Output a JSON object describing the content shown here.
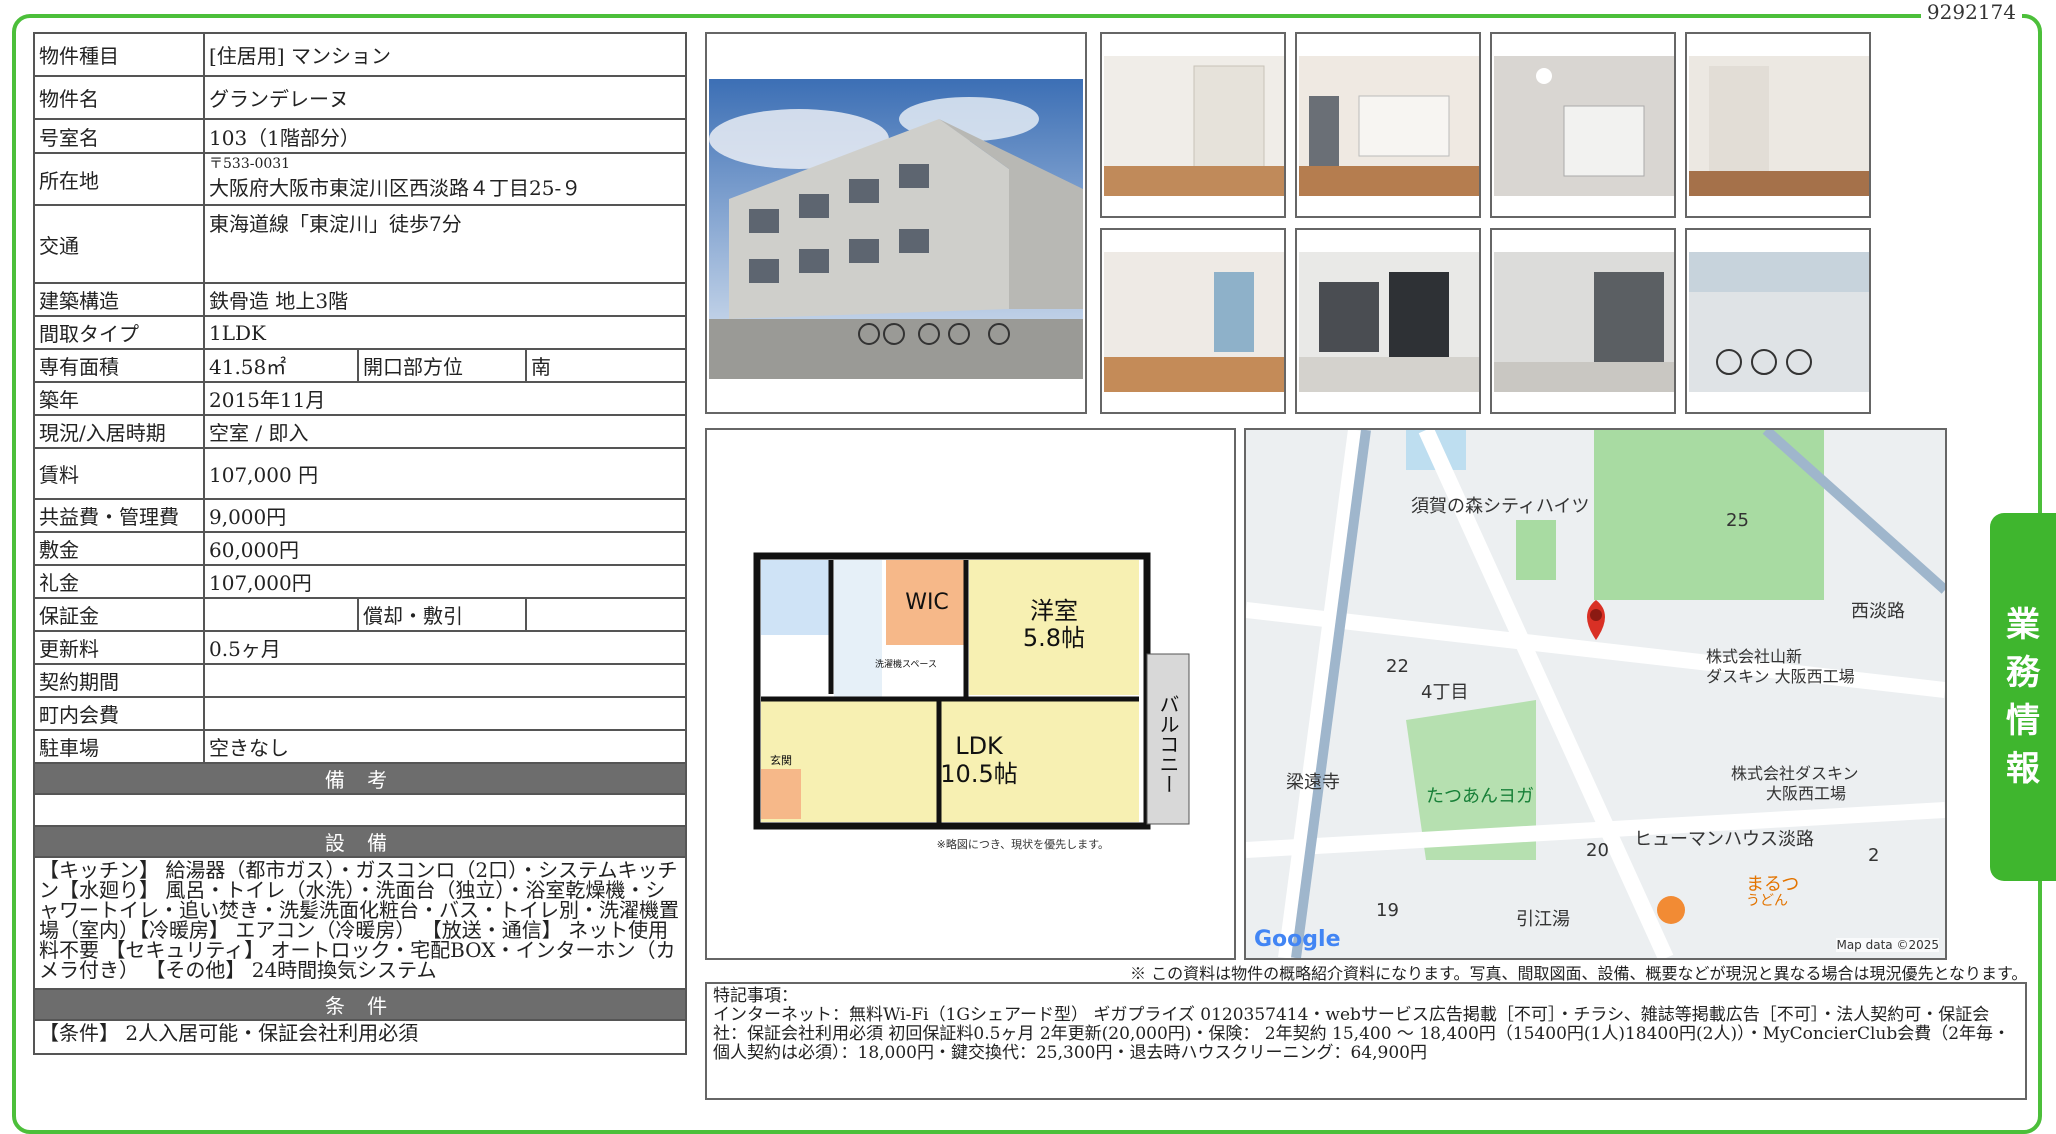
{
  "doc_id": "9292174",
  "side_tab": [
    "業",
    "務",
    "情",
    "報"
  ],
  "spec": {
    "type_label": "物件種目",
    "type_value": "[住居用]  マンション",
    "name_label": "物件名",
    "name_value": "グランデレーヌ",
    "room_label": "号室名",
    "room_value": "103（1階部分）",
    "address_label": "所在地",
    "postal": "〒533-0031",
    "address_value": "大阪府大阪市東淀川区西淡路４丁目25-９",
    "access_label": "交通",
    "access_value": "東海道線「東淀川」徒歩7分",
    "structure_label": "建築構造",
    "structure_value": "鉄骨造 地上3階",
    "layout_label": "間取タイプ",
    "layout_value": "1LDK",
    "area_label": "専有面積",
    "area_value": "41.58㎡",
    "direction_label": "開口部方位",
    "direction_value": "南",
    "built_label": "築年",
    "built_value": "2015年11月",
    "status_label": "現況/入居時期",
    "status_value": "空室 / 即入",
    "rent_label": "賃料",
    "rent_value": "107,000 円",
    "fee_label": "共益費・管理費",
    "fee_value": "9,000円",
    "deposit_label": "敷金",
    "deposit_value": "60,000円",
    "key_money_label": "礼金",
    "key_money_value": "107,000円",
    "guarantee_label": "保証金",
    "guarantee_value": "",
    "amort_label": "償却・敷引",
    "amort_value": "",
    "renewal_label": "更新料",
    "renewal_value": "0.5ヶ月",
    "contract_label": "契約期間",
    "contract_value": "",
    "community_label": "町内会費",
    "community_value": "",
    "parking_label": "駐車場",
    "parking_value": "空きなし"
  },
  "sections": {
    "remarks_title": "備 考",
    "remarks_text": "",
    "equip_title": "設 備",
    "equip_text": "【キッチン】 給湯器（都市ガス）・ガスコンロ（2口）・システムキッチン【水廻り】 風呂・トイレ（水洗）・洗面台（独立）・浴室乾燥機・シャワートイレ・追い焚き・洗髪洗面化粧台・バス・トイレ別・洗濯機置場（室内）【冷暖房】 エアコン（冷暖房） 【放送・通信】 ネット使用料不要 【セキュリティ】 オートロック・宅配BOX・インターホン（カメラ付き） 【その他】 24時間換気システム",
    "cond_title": "条 件",
    "cond_text": "【条件】 2人入居可能・保証会社利用必須"
  },
  "floorplan": {
    "wic": "WIC",
    "western_room": "洋室",
    "western_size": "5.8帖",
    "ldk": "LDK",
    "ldk_size": "10.5帖",
    "balcony": "バルコニー",
    "washer": "洗濯機スペース",
    "entrance": "玄関",
    "caption": "※略図につき、現状を優先します。"
  },
  "map": {
    "labels": [
      "須賀の森シティハイツ",
      "25",
      "西淡路",
      "株式会社山新",
      "ダスキン 大阪西工場",
      "22",
      "4丁目",
      "株式会社ダスキン",
      "大阪西工場",
      "梁遠寺",
      "たつあんヨガ",
      "ヒューマンハウス淡路",
      "20",
      "2",
      "まるつ",
      "うどん",
      "19",
      "引江湯"
    ],
    "google": "Google",
    "credit": "Map data ©2025"
  },
  "footnote": "※ この資料は物件の概略紹介資料になります。写真、間取図面、設備、概要などが現況と異なる場合は現況優先となります。",
  "special": {
    "title": "特記事項：",
    "text": "インターネット：無料Wi-Fi（1Gシェアード型） ギガプライズ 0120357414・webサービス広告掲載［不可］・チラシ、雑誌等掲載広告［不可］・法人契約可・保証会社：保証会社利用必須 初回保証料0.5ヶ月 2年更新(20,000円)・保険： 2年契約 15,400 ～ 18,400円（15400円(1人)18400円(2人)）・MyConcierClub会費（2年毎・個人契約は必須）：18,000円・鍵交換代：25,300円・退去時ハウスクリーニング：64,900円"
  },
  "colors": {
    "accent": "#3fb62e",
    "section": "#6d6d6d"
  }
}
